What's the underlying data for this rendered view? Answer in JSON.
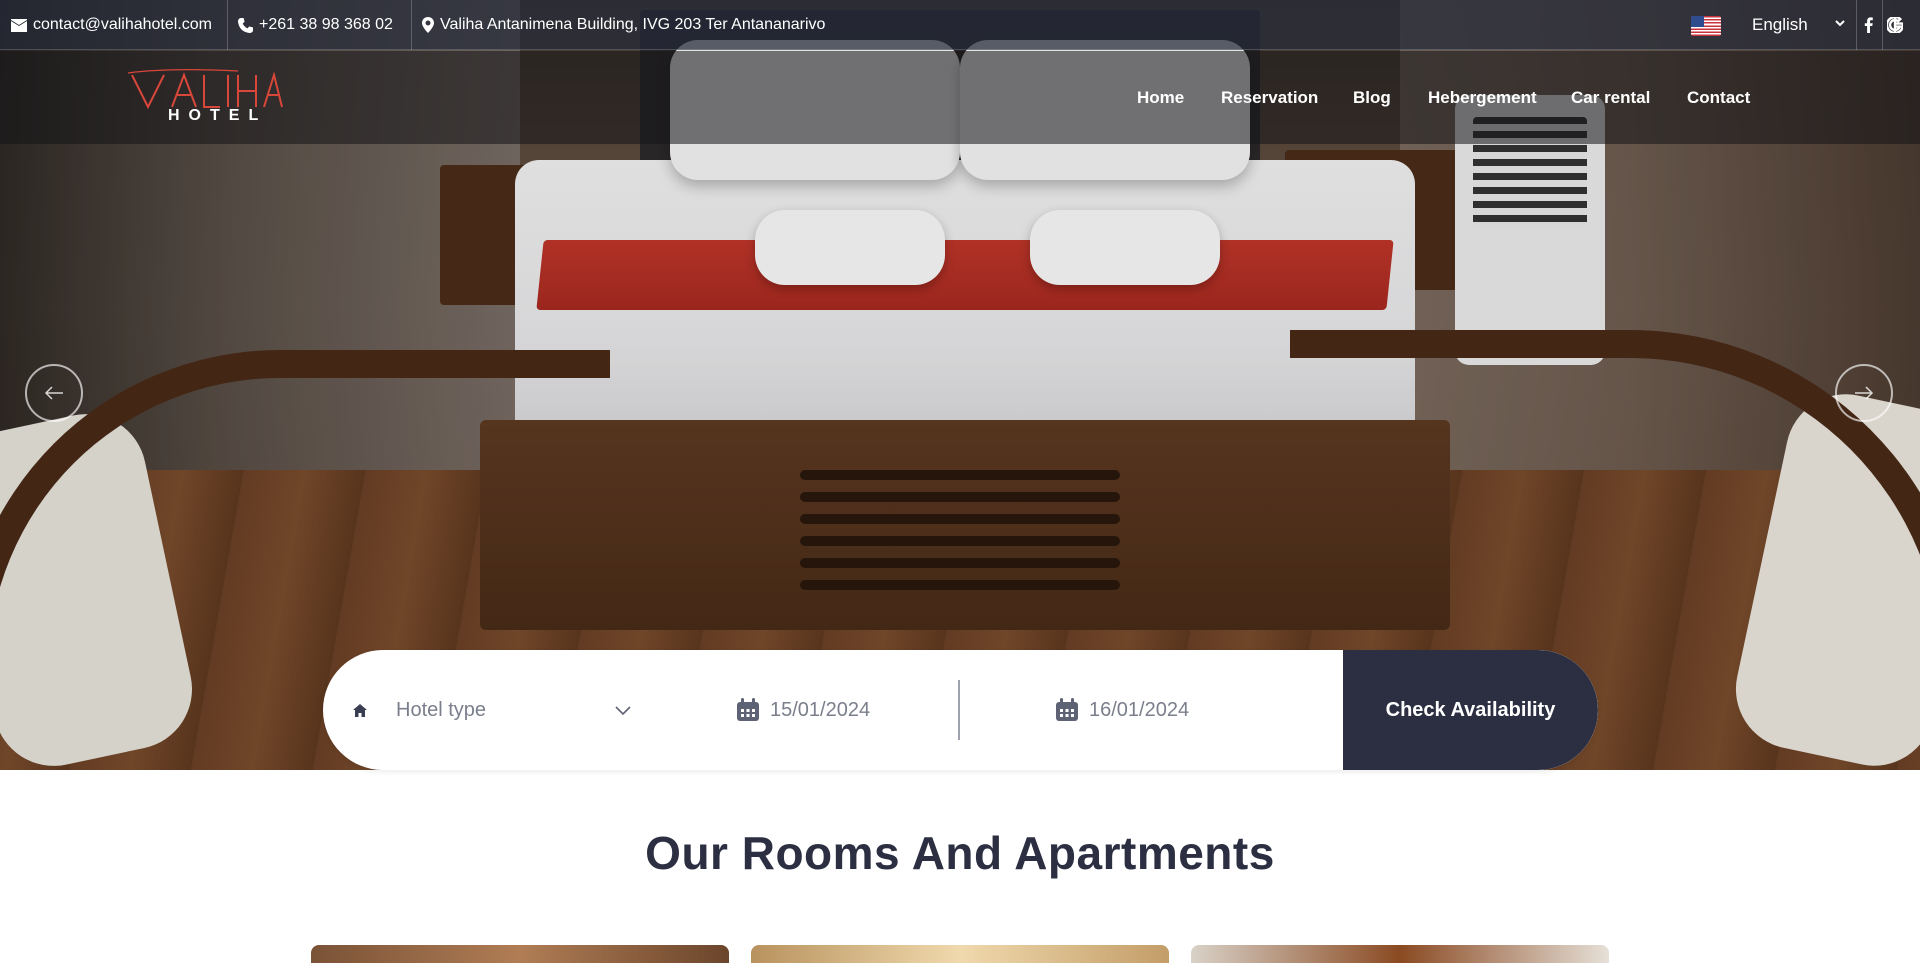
{
  "topbar": {
    "email": "contact@valihahotel.com",
    "phone": "+261 38 98 368 02",
    "address": "Valiha Antanimena Building, IVG 203 Ter Antananarivo",
    "language": "English",
    "icons": [
      "envelope-icon",
      "phone-icon",
      "map-pin-icon",
      "us-flag-icon",
      "facebook-icon",
      "google-icon"
    ]
  },
  "brand": {
    "logo_script": "VALIHA",
    "logo_text": "HOTEL",
    "accent_color": "#d9463a"
  },
  "nav": {
    "items": [
      "Home",
      "Reservation",
      "Blog",
      "Hebergement",
      "Car rental",
      "Contact"
    ]
  },
  "slider": {
    "prev_icon": "arrow-left-icon",
    "next_icon": "arrow-right-icon"
  },
  "booking": {
    "hotel_type_placeholder": "Hotel type",
    "check_in": "15/01/2024",
    "check_out": "16/01/2024",
    "button_label": "Check Availability",
    "button_color": "#2c2f42"
  },
  "section": {
    "title": "Our Rooms And Apartments"
  }
}
